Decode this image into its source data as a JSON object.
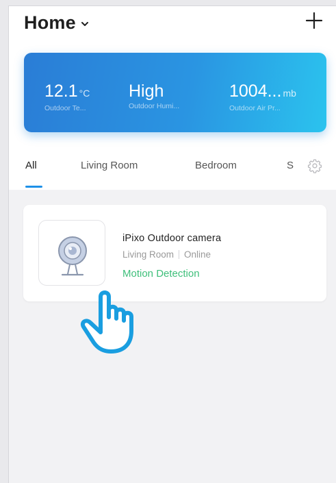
{
  "header": {
    "title": "Home",
    "dropdown_icon": "chevron-down-icon",
    "add_icon": "plus-icon"
  },
  "weather": {
    "temperature": {
      "value": "12.1",
      "unit": "°C",
      "label": "Outdoor Te..."
    },
    "humidity": {
      "value": "High",
      "label": "Outdoor Humi..."
    },
    "pressure": {
      "value": "1004...",
      "unit": "mb",
      "label": "Outdoor Air Pr..."
    }
  },
  "tabs": {
    "items": [
      "All",
      "Living Room",
      "Bedroom"
    ],
    "truncated": "S",
    "active": "All",
    "settings_icon": "gear-icon"
  },
  "device": {
    "name": "iPixo Outdoor camera",
    "room": "Living Room",
    "status": "Online",
    "event": "Motion Detection",
    "icon": "camera-icon"
  },
  "overlay": {
    "icon": "pointing-hand-icon"
  },
  "colors": {
    "accent": "#1e90e8",
    "weather_gradient_start": "#2a7dd6",
    "weather_gradient_end": "#2bc3ee",
    "event_green": "#3ebf7a",
    "hand_stroke": "#1a9ee0"
  }
}
